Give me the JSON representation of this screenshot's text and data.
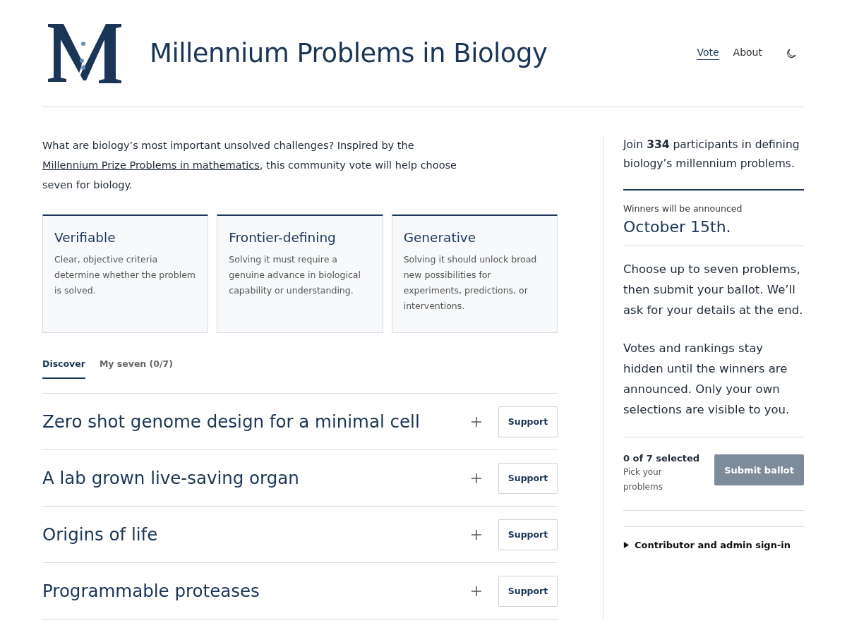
{
  "header": {
    "title": "Millennium Problems in Biology",
    "nav": [
      {
        "label": "Vote",
        "selected": true
      },
      {
        "label": "About",
        "selected": false
      }
    ]
  },
  "intro": {
    "before": "What are biology’s most important unsolved challenges? Inspired by the ",
    "link": "Millennium Prize Problems in mathematics",
    "after": ", this community vote will help choose seven for biology."
  },
  "criteria": [
    {
      "title": "Verifiable",
      "text": "Clear, objective criteria determine whether the problem is solved."
    },
    {
      "title": "Frontier-defining",
      "text": "Solving it must require a genuine advance in biological capability or understanding."
    },
    {
      "title": "Generative",
      "text": "Solving it should unlock broad new possibilities for experiments, predictions, or interventions."
    }
  ],
  "tabs": [
    {
      "label": "Discover",
      "selected": true
    },
    {
      "label": "My seven (0/7)",
      "selected": false
    }
  ],
  "problems": [
    {
      "title": "Zero shot genome design for a minimal cell",
      "button": "Support"
    },
    {
      "title": "A lab grown live-saving organ",
      "button": "Support"
    },
    {
      "title": "Origins of life",
      "button": "Support"
    },
    {
      "title": "Programmable proteases",
      "button": "Support"
    }
  ],
  "sidebar": {
    "join": "Join **334** participants in defining biology’s millennium problems.",
    "announce_label": "Winners will be announced",
    "announce_date": "October 15th.",
    "paragraphs": [
      "Choose up to seven problems, then submit your ballot. We’ll ask for your details at the end.",
      "Votes and rankings stay hidden until the winners are announced. Only your own selections are visible to you."
    ],
    "selected_count": "0 of 7 selected",
    "hint": "Pick your problems",
    "submit": {
      "label": "Submit ballot",
      "disabled": true
    },
    "signin": {
      "label": "Contributor and admin sign-in",
      "expanded": false
    }
  }
}
